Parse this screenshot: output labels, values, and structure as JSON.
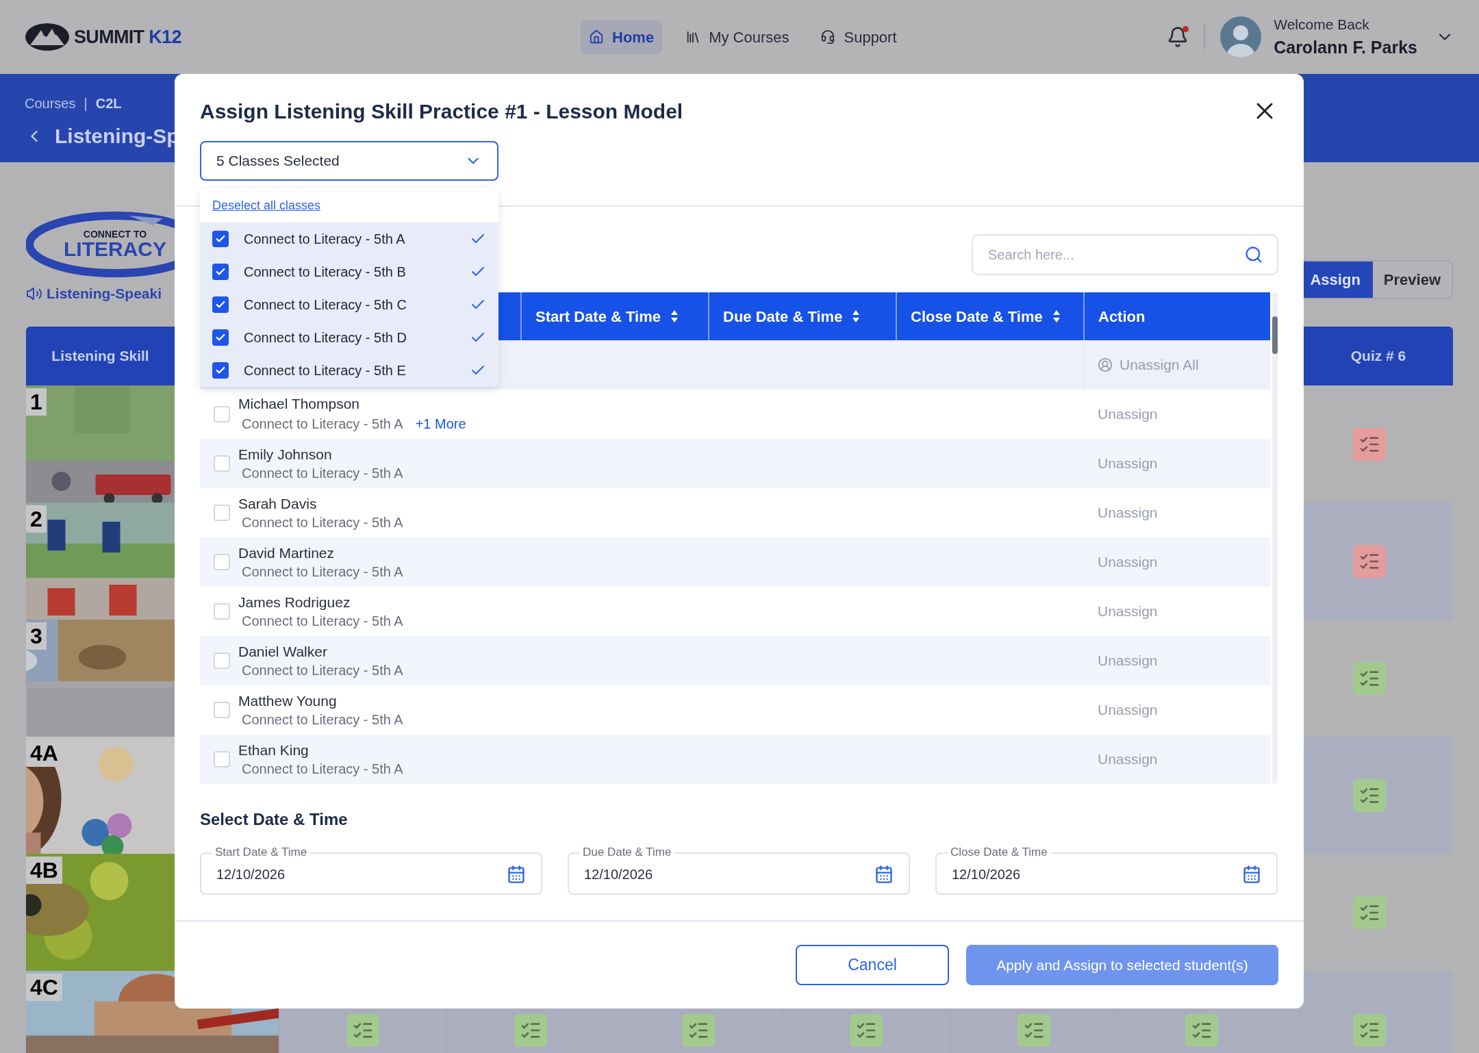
{
  "header": {
    "logo": {
      "name": "SUMMIT",
      "suffix": "K12"
    },
    "nav": [
      {
        "label": "Home",
        "selected": true
      },
      {
        "label": "My Courses",
        "selected": false
      },
      {
        "label": "Support",
        "selected": false
      }
    ],
    "notifications": {
      "unread": true
    },
    "user": {
      "greeting": "Welcome Back",
      "name": "Carolann F. Parks"
    }
  },
  "breadcrumb": {
    "items": [
      "Courses",
      "C2L"
    ],
    "separator": "|"
  },
  "page_title": "Listening-Sp",
  "program": {
    "logo_top": "CONNECT TO",
    "logo_main": "LITERACY",
    "subtitle": "Listening-Speaki"
  },
  "view_tabs": [
    {
      "label": "Assign",
      "selected": true
    },
    {
      "label": "Preview",
      "selected": false
    }
  ],
  "lesson_table": {
    "first_column": "Listening Skill",
    "last_column": "Quiz # 6",
    "rows": [
      {
        "label": "1",
        "icons": [
          {
            "color": "#e59c9c"
          }
        ]
      },
      {
        "label": "2",
        "icons": [
          {
            "color": "#e59c9c"
          }
        ]
      },
      {
        "label": "3",
        "icons": [
          {
            "color": "#a3c98f"
          }
        ]
      },
      {
        "label": "4A",
        "icons": [
          {
            "color": "#a3c98f"
          }
        ]
      },
      {
        "label": "4B",
        "icons": [
          {
            "color": "#a3c98f"
          }
        ]
      },
      {
        "label": "4C",
        "icons": [
          {
            "color": "#a3c98f"
          },
          {
            "color": "#a3c98f"
          },
          {
            "color": "#a3c98f"
          },
          {
            "color": "#a3c98f"
          },
          {
            "color": "#a3c98f"
          },
          {
            "color": "#a3c98f"
          },
          {
            "color": "#a3c98f"
          }
        ]
      }
    ]
  },
  "modal": {
    "title": "Assign Listening Skill Practice #1 - Lesson Model",
    "class_select": {
      "value": "5 Classes Selected",
      "expanded": true
    },
    "class_menu": {
      "deselect_link": "Deselect all classes",
      "options": [
        {
          "label": "Connect to Literacy - 5th A",
          "checked": true
        },
        {
          "label": "Connect to Literacy - 5th B",
          "checked": true
        },
        {
          "label": "Connect to Literacy - 5th C",
          "checked": true
        },
        {
          "label": "Connect to Literacy - 5th D",
          "checked": true
        },
        {
          "label": "Connect to Literacy - 5th E",
          "checked": true
        }
      ]
    },
    "search": {
      "placeholder": "Search here..."
    },
    "table": {
      "columns": [
        {
          "label": "Start Date & Time",
          "sortable": true
        },
        {
          "label": "Due Date & Time",
          "sortable": true
        },
        {
          "label": "Close Date & Time",
          "sortable": true
        },
        {
          "label": "Action",
          "sortable": false
        }
      ],
      "unassign_all": {
        "label": "Unassign All",
        "disabled": true
      },
      "rows": [
        {
          "name": "Michael Thompson",
          "class": "Connect to Literacy - 5th A",
          "more": "+1 More",
          "checked": false,
          "action": "Unassign",
          "disabled": true
        },
        {
          "name": "Emily Johnson",
          "class": "Connect to Literacy - 5th A",
          "checked": false,
          "action": "Unassign",
          "disabled": true
        },
        {
          "name": "Sarah Davis",
          "class": "Connect to Literacy - 5th A",
          "checked": false,
          "action": "Unassign",
          "disabled": true
        },
        {
          "name": "David Martinez",
          "class": "Connect to Literacy - 5th A",
          "checked": false,
          "action": "Unassign",
          "disabled": true
        },
        {
          "name": "James Rodriguez",
          "class": "Connect to Literacy - 5th A",
          "checked": false,
          "action": "Unassign",
          "disabled": true
        },
        {
          "name": "Daniel Walker",
          "class": "Connect to Literacy - 5th A",
          "checked": false,
          "action": "Unassign",
          "disabled": true
        },
        {
          "name": "Matthew Young",
          "class": "Connect to Literacy - 5th A",
          "checked": false,
          "action": "Unassign",
          "disabled": true
        },
        {
          "name": "Ethan King",
          "class": "Connect to Literacy - 5th A",
          "checked": false,
          "action": "Unassign",
          "disabled": true
        }
      ]
    },
    "date_section": {
      "title": "Select Date & Time",
      "fields": [
        {
          "label": "Start Date & Time",
          "value": "12/10/2026"
        },
        {
          "label": "Due Date & Time",
          "value": "12/10/2026"
        },
        {
          "label": "Close Date & Time",
          "value": "12/10/2026"
        }
      ]
    },
    "buttons": {
      "cancel": "Cancel",
      "apply": {
        "label": "Apply and Assign to selected student(s)",
        "disabled": true
      }
    }
  }
}
